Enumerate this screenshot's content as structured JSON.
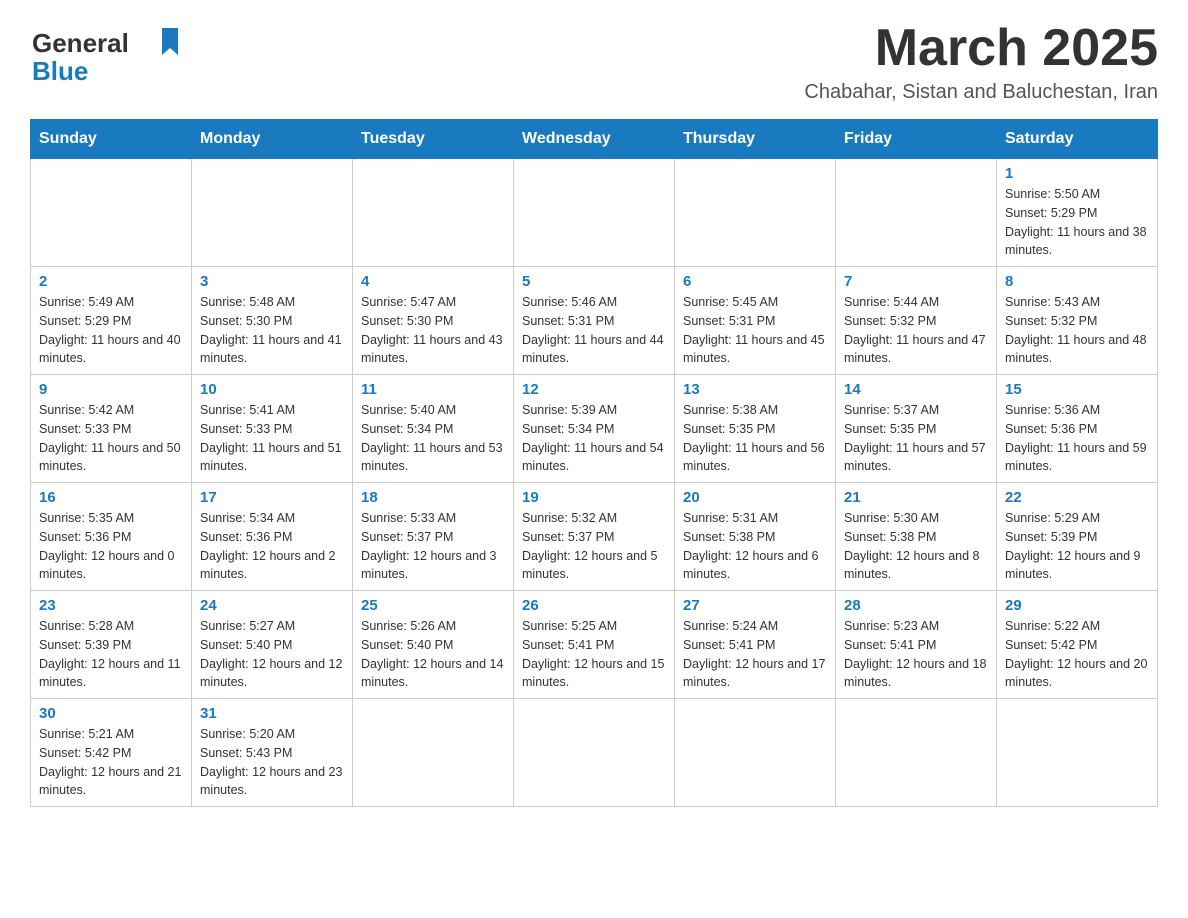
{
  "header": {
    "logo_line1": "General",
    "logo_line2": "Blue",
    "month": "March 2025",
    "location": "Chabahar, Sistan and Baluchestan, Iran"
  },
  "weekdays": [
    "Sunday",
    "Monday",
    "Tuesday",
    "Wednesday",
    "Thursday",
    "Friday",
    "Saturday"
  ],
  "weeks": [
    [
      {
        "day": "",
        "sunrise": "",
        "sunset": "",
        "daylight": ""
      },
      {
        "day": "",
        "sunrise": "",
        "sunset": "",
        "daylight": ""
      },
      {
        "day": "",
        "sunrise": "",
        "sunset": "",
        "daylight": ""
      },
      {
        "day": "",
        "sunrise": "",
        "sunset": "",
        "daylight": ""
      },
      {
        "day": "",
        "sunrise": "",
        "sunset": "",
        "daylight": ""
      },
      {
        "day": "",
        "sunrise": "",
        "sunset": "",
        "daylight": ""
      },
      {
        "day": "1",
        "sunrise": "Sunrise: 5:50 AM",
        "sunset": "Sunset: 5:29 PM",
        "daylight": "Daylight: 11 hours and 38 minutes."
      }
    ],
    [
      {
        "day": "2",
        "sunrise": "Sunrise: 5:49 AM",
        "sunset": "Sunset: 5:29 PM",
        "daylight": "Daylight: 11 hours and 40 minutes."
      },
      {
        "day": "3",
        "sunrise": "Sunrise: 5:48 AM",
        "sunset": "Sunset: 5:30 PM",
        "daylight": "Daylight: 11 hours and 41 minutes."
      },
      {
        "day": "4",
        "sunrise": "Sunrise: 5:47 AM",
        "sunset": "Sunset: 5:30 PM",
        "daylight": "Daylight: 11 hours and 43 minutes."
      },
      {
        "day": "5",
        "sunrise": "Sunrise: 5:46 AM",
        "sunset": "Sunset: 5:31 PM",
        "daylight": "Daylight: 11 hours and 44 minutes."
      },
      {
        "day": "6",
        "sunrise": "Sunrise: 5:45 AM",
        "sunset": "Sunset: 5:31 PM",
        "daylight": "Daylight: 11 hours and 45 minutes."
      },
      {
        "day": "7",
        "sunrise": "Sunrise: 5:44 AM",
        "sunset": "Sunset: 5:32 PM",
        "daylight": "Daylight: 11 hours and 47 minutes."
      },
      {
        "day": "8",
        "sunrise": "Sunrise: 5:43 AM",
        "sunset": "Sunset: 5:32 PM",
        "daylight": "Daylight: 11 hours and 48 minutes."
      }
    ],
    [
      {
        "day": "9",
        "sunrise": "Sunrise: 5:42 AM",
        "sunset": "Sunset: 5:33 PM",
        "daylight": "Daylight: 11 hours and 50 minutes."
      },
      {
        "day": "10",
        "sunrise": "Sunrise: 5:41 AM",
        "sunset": "Sunset: 5:33 PM",
        "daylight": "Daylight: 11 hours and 51 minutes."
      },
      {
        "day": "11",
        "sunrise": "Sunrise: 5:40 AM",
        "sunset": "Sunset: 5:34 PM",
        "daylight": "Daylight: 11 hours and 53 minutes."
      },
      {
        "day": "12",
        "sunrise": "Sunrise: 5:39 AM",
        "sunset": "Sunset: 5:34 PM",
        "daylight": "Daylight: 11 hours and 54 minutes."
      },
      {
        "day": "13",
        "sunrise": "Sunrise: 5:38 AM",
        "sunset": "Sunset: 5:35 PM",
        "daylight": "Daylight: 11 hours and 56 minutes."
      },
      {
        "day": "14",
        "sunrise": "Sunrise: 5:37 AM",
        "sunset": "Sunset: 5:35 PM",
        "daylight": "Daylight: 11 hours and 57 minutes."
      },
      {
        "day": "15",
        "sunrise": "Sunrise: 5:36 AM",
        "sunset": "Sunset: 5:36 PM",
        "daylight": "Daylight: 11 hours and 59 minutes."
      }
    ],
    [
      {
        "day": "16",
        "sunrise": "Sunrise: 5:35 AM",
        "sunset": "Sunset: 5:36 PM",
        "daylight": "Daylight: 12 hours and 0 minutes."
      },
      {
        "day": "17",
        "sunrise": "Sunrise: 5:34 AM",
        "sunset": "Sunset: 5:36 PM",
        "daylight": "Daylight: 12 hours and 2 minutes."
      },
      {
        "day": "18",
        "sunrise": "Sunrise: 5:33 AM",
        "sunset": "Sunset: 5:37 PM",
        "daylight": "Daylight: 12 hours and 3 minutes."
      },
      {
        "day": "19",
        "sunrise": "Sunrise: 5:32 AM",
        "sunset": "Sunset: 5:37 PM",
        "daylight": "Daylight: 12 hours and 5 minutes."
      },
      {
        "day": "20",
        "sunrise": "Sunrise: 5:31 AM",
        "sunset": "Sunset: 5:38 PM",
        "daylight": "Daylight: 12 hours and 6 minutes."
      },
      {
        "day": "21",
        "sunrise": "Sunrise: 5:30 AM",
        "sunset": "Sunset: 5:38 PM",
        "daylight": "Daylight: 12 hours and 8 minutes."
      },
      {
        "day": "22",
        "sunrise": "Sunrise: 5:29 AM",
        "sunset": "Sunset: 5:39 PM",
        "daylight": "Daylight: 12 hours and 9 minutes."
      }
    ],
    [
      {
        "day": "23",
        "sunrise": "Sunrise: 5:28 AM",
        "sunset": "Sunset: 5:39 PM",
        "daylight": "Daylight: 12 hours and 11 minutes."
      },
      {
        "day": "24",
        "sunrise": "Sunrise: 5:27 AM",
        "sunset": "Sunset: 5:40 PM",
        "daylight": "Daylight: 12 hours and 12 minutes."
      },
      {
        "day": "25",
        "sunrise": "Sunrise: 5:26 AM",
        "sunset": "Sunset: 5:40 PM",
        "daylight": "Daylight: 12 hours and 14 minutes."
      },
      {
        "day": "26",
        "sunrise": "Sunrise: 5:25 AM",
        "sunset": "Sunset: 5:41 PM",
        "daylight": "Daylight: 12 hours and 15 minutes."
      },
      {
        "day": "27",
        "sunrise": "Sunrise: 5:24 AM",
        "sunset": "Sunset: 5:41 PM",
        "daylight": "Daylight: 12 hours and 17 minutes."
      },
      {
        "day": "28",
        "sunrise": "Sunrise: 5:23 AM",
        "sunset": "Sunset: 5:41 PM",
        "daylight": "Daylight: 12 hours and 18 minutes."
      },
      {
        "day": "29",
        "sunrise": "Sunrise: 5:22 AM",
        "sunset": "Sunset: 5:42 PM",
        "daylight": "Daylight: 12 hours and 20 minutes."
      }
    ],
    [
      {
        "day": "30",
        "sunrise": "Sunrise: 5:21 AM",
        "sunset": "Sunset: 5:42 PM",
        "daylight": "Daylight: 12 hours and 21 minutes."
      },
      {
        "day": "31",
        "sunrise": "Sunrise: 5:20 AM",
        "sunset": "Sunset: 5:43 PM",
        "daylight": "Daylight: 12 hours and 23 minutes."
      },
      {
        "day": "",
        "sunrise": "",
        "sunset": "",
        "daylight": ""
      },
      {
        "day": "",
        "sunrise": "",
        "sunset": "",
        "daylight": ""
      },
      {
        "day": "",
        "sunrise": "",
        "sunset": "",
        "daylight": ""
      },
      {
        "day": "",
        "sunrise": "",
        "sunset": "",
        "daylight": ""
      },
      {
        "day": "",
        "sunrise": "",
        "sunset": "",
        "daylight": ""
      }
    ]
  ]
}
